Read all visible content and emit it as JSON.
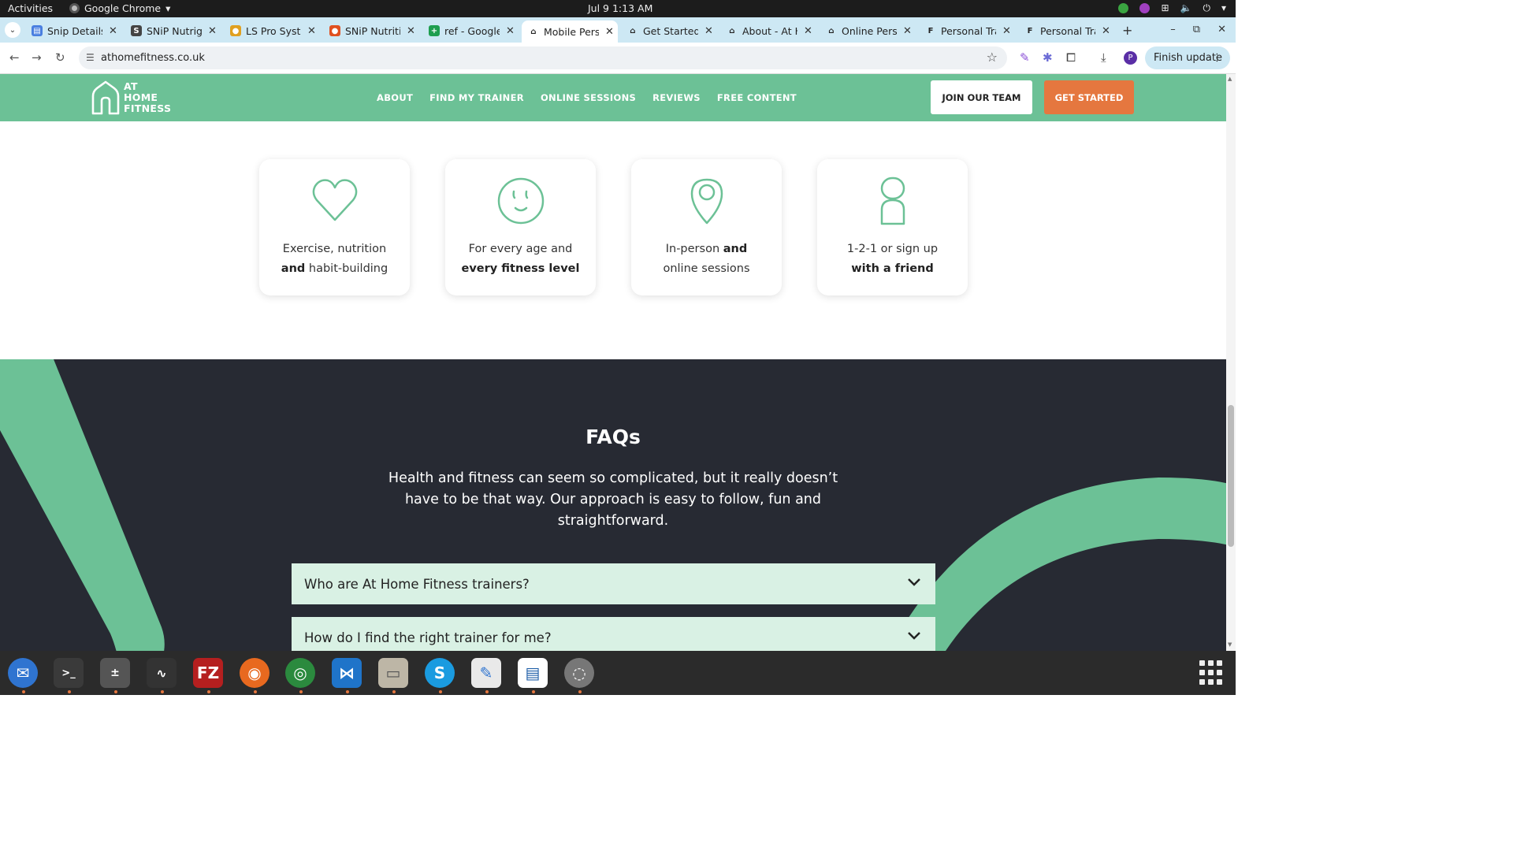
{
  "topbar": {
    "activities": "Activities",
    "app_name": "Google Chrome",
    "clock": "Jul 9  1:13 AM"
  },
  "tabs": [
    {
      "title": "Snip Details",
      "icon": "docs-icon"
    },
    {
      "title": "SNiP Nutrigenomics",
      "icon": "snip-icon"
    },
    {
      "title": "LS Pro Systems",
      "icon": "ls-pro-icon"
    },
    {
      "title": "SNiP Nutrition",
      "icon": "snip-nutrition-icon"
    },
    {
      "title": "ref - Google Sheets",
      "icon": "sheets-icon"
    },
    {
      "title": "Mobile Personal",
      "icon": "athome-icon",
      "active": true
    },
    {
      "title": "Get Started",
      "icon": "athome-icon"
    },
    {
      "title": "About - At Home",
      "icon": "athome-icon"
    },
    {
      "title": "Online Personal",
      "icon": "athome-icon"
    },
    {
      "title": "Personal Trainer",
      "icon": "fs-icon"
    },
    {
      "title": "Personal Trainer",
      "icon": "fs-icon"
    }
  ],
  "browser": {
    "url": "athomefitness.co.uk",
    "finish_update": "Finish update",
    "profile_initial": "P"
  },
  "site": {
    "logo_lines": [
      "AT",
      "HOME",
      "FITNESS"
    ],
    "nav": [
      "ABOUT",
      "FIND MY TRAINER",
      "ONLINE SESSIONS",
      "REVIEWS",
      "FREE CONTENT"
    ],
    "join_button": "JOIN OUR TEAM",
    "start_button": "GET STARTED",
    "accent_green": "#6cc196",
    "accent_orange": "#e5773f",
    "dark_bg": "#272a33"
  },
  "features": [
    {
      "icon": "heart-icon",
      "line1": "Exercise, nutrition",
      "line2_bold": "and",
      "line2_rest": " habit-building"
    },
    {
      "icon": "smiley-icon",
      "line1": "For every age and",
      "line2_bold": "every fitness level",
      "line2_rest": ""
    },
    {
      "icon": "location-pin-icon",
      "line1_pre": "In-person ",
      "line1_bold": "and",
      "line2": "online sessions"
    },
    {
      "icon": "person-icon",
      "line1": "1-2-1 or sign up",
      "line2_bold": "with a friend",
      "line2_rest": ""
    }
  ],
  "faq": {
    "title": "FAQs",
    "intro": "Health and fitness can seem so complicated, but it really doesn’t have to be that way. Our approach is easy to follow, fun and straightforward.",
    "items": [
      "Who are At Home Fitness trainers?",
      "How do I find the right trainer for me?"
    ]
  },
  "dock": [
    "thunderbird-icon",
    "terminal-icon",
    "calculator-icon",
    "system-monitor-icon",
    "filezilla-icon",
    "firefox-icon",
    "chrome-icon",
    "vscode-icon",
    "files-icon",
    "skype-icon",
    "text-editor-icon",
    "document-viewer-icon",
    "disk-icon"
  ]
}
